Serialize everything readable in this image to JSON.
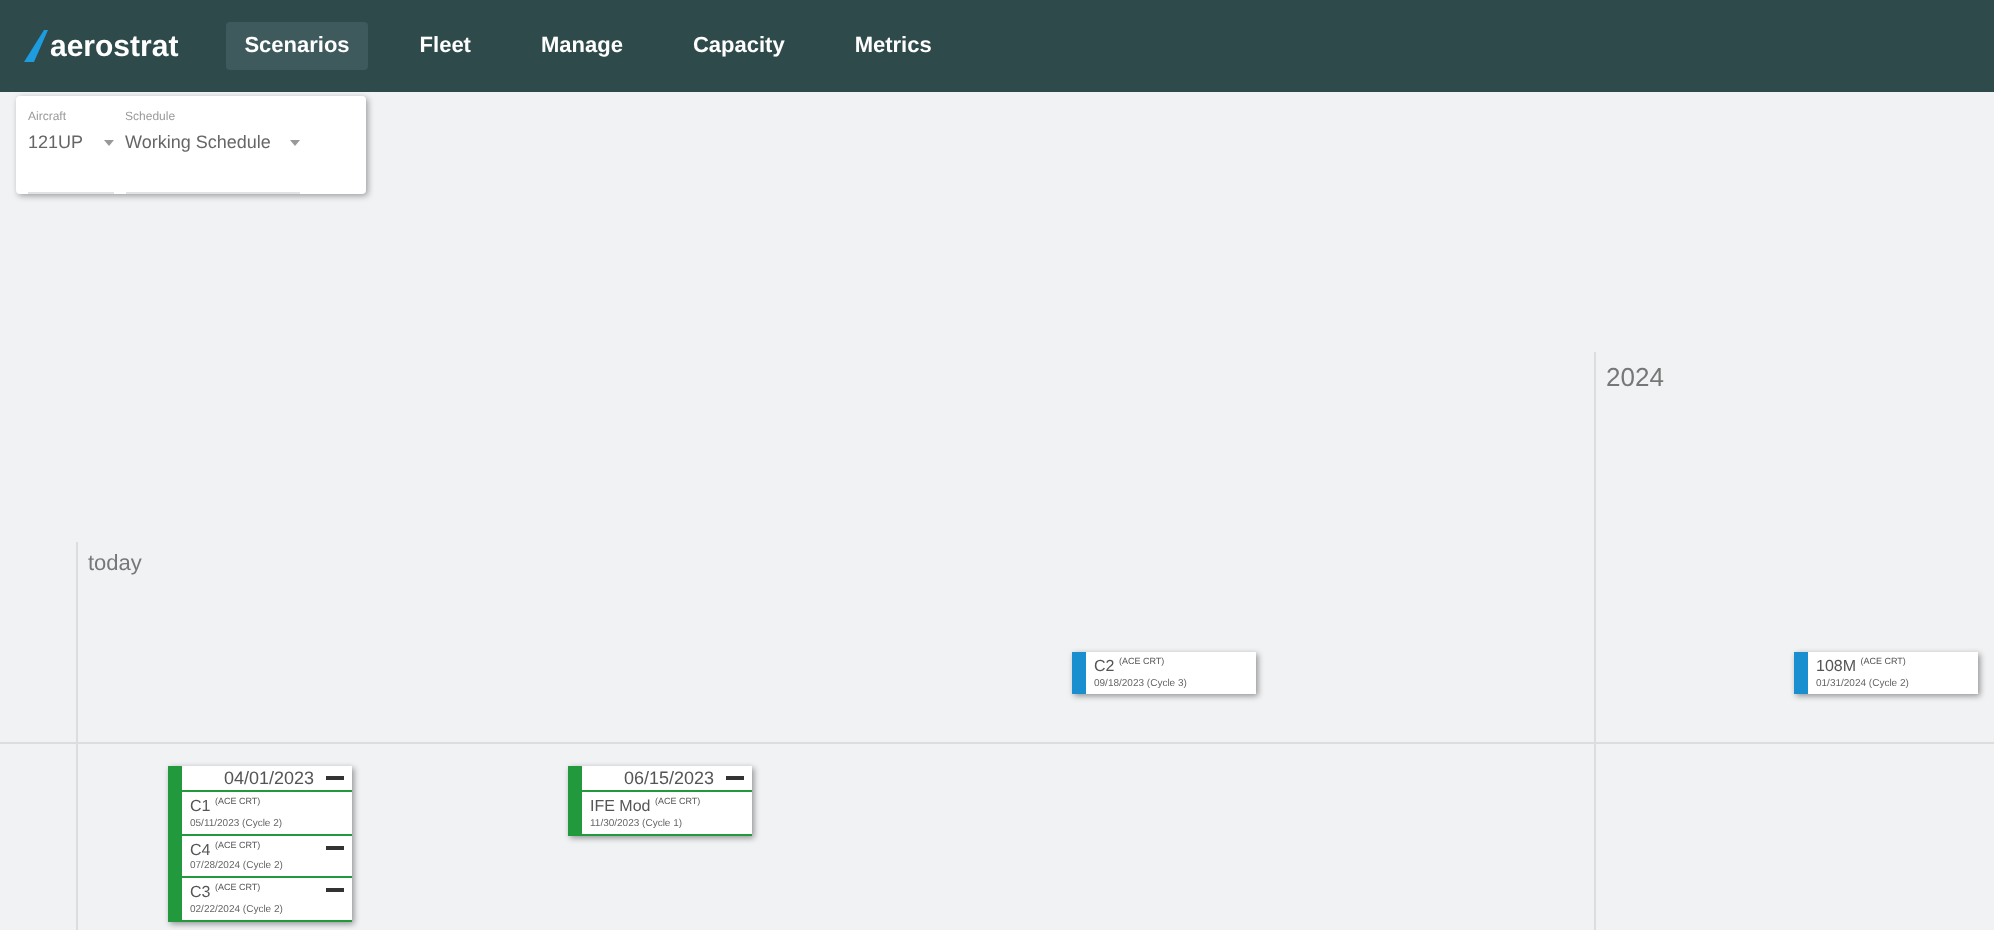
{
  "nav": {
    "logo": "aerostrat",
    "tabs": [
      {
        "label": "Scenarios",
        "selected": true
      },
      {
        "label": "Fleet",
        "selected": false
      },
      {
        "label": "Manage",
        "selected": false
      },
      {
        "label": "Capacity",
        "selected": false
      },
      {
        "label": "Metrics",
        "selected": false
      }
    ]
  },
  "filters": [
    {
      "label": "Aircraft",
      "value": "121UP"
    },
    {
      "label": "Schedule",
      "value": "Working Schedule"
    }
  ],
  "timeline": {
    "markers": [
      {
        "label": "today"
      },
      {
        "label": "2024"
      }
    ],
    "events": [
      {
        "title": "C2 $^{(ACE CRT)}$",
        "date": "09/18/2023 (Cycle 3)"
      },
      {
        "title": "108M $^{(ACE CRT)}$",
        "date": "01/31/2024 (Cycle 2)"
      }
    ],
    "groups": [
      {
        "date": "04/01/2023",
        "items": [
          {
            "title": "C1 $^{(ACE CRT)}$",
            "date": "05/11/2023 (Cycle 2)",
            "removable": false
          },
          {
            "title": "C4 $^{(ACE CRT)}$",
            "date": "07/28/2024 (Cycle 2)",
            "removable": true
          },
          {
            "title": "C3 $^{(ACE CRT)}$",
            "date": "02/22/2024 (Cycle 2)",
            "removable": true
          }
        ]
      },
      {
        "date": "06/15/2023",
        "items": [
          {
            "title": "IFE Mod $^{(ACE CRT)}$",
            "date": "11/30/2023 (Cycle 1)",
            "removable": false
          }
        ]
      }
    ]
  }
}
